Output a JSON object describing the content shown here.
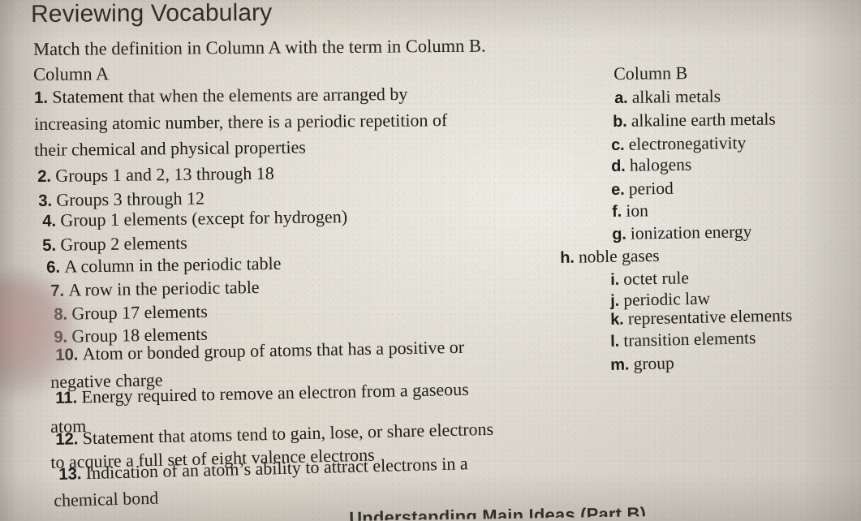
{
  "document": {
    "title": "Reviewing Vocabulary",
    "instruction": "Match the definition in Column A with the term in Column B.",
    "bleed_through_text": "        "
  },
  "column_a": {
    "heading": "Column A",
    "items": [
      {
        "number": "1.",
        "text": "Statement that when the elements are arranged by"
      },
      {
        "number": "",
        "text": "increasing atomic number, there is a periodic repetition of"
      },
      {
        "number": "",
        "text": "their chemical and physical properties"
      },
      {
        "number": "2.",
        "text": "Groups 1 and 2, 13 through 18"
      },
      {
        "number": "3.",
        "text": "Groups 3 through 12"
      },
      {
        "number": "4.",
        "text": "Group 1 elements (except for hydrogen)"
      },
      {
        "number": "5.",
        "text": "Group 2 elements"
      },
      {
        "number": "6.",
        "text": "A column in the periodic table"
      },
      {
        "number": "7.",
        "text": "A row in the periodic table"
      },
      {
        "number": "8.",
        "text": "Group 17 elements"
      },
      {
        "number": "9.",
        "text": "Group 18 elements"
      },
      {
        "number": "10.",
        "text": "Atom or bonded group of atoms that has a positive or"
      },
      {
        "number": "",
        "text": "negative charge"
      },
      {
        "number": "11.",
        "text": "Energy required to remove an electron from a gaseous"
      },
      {
        "number": "",
        "text": "atom"
      },
      {
        "number": "12.",
        "text": "Statement that atoms tend to gain, lose, or share electrons"
      },
      {
        "number": "",
        "text": "to acquire a full set of eight valence electrons"
      },
      {
        "number": "13.",
        "text": "Indication of an atom’s ability to attract electrons in a"
      },
      {
        "number": "",
        "text": "chemical bond"
      }
    ]
  },
  "column_b": {
    "heading": "Column B",
    "items": [
      {
        "letter": "a.",
        "text": "alkali metals"
      },
      {
        "letter": "b.",
        "text": "alkaline earth metals"
      },
      {
        "letter": "c.",
        "text": "electronegativity"
      },
      {
        "letter": "d.",
        "text": "halogens"
      },
      {
        "letter": "e.",
        "text": "period"
      },
      {
        "letter": "f.",
        "text": "ion"
      },
      {
        "letter": "g.",
        "text": "ionization energy"
      },
      {
        "letter": "h.",
        "text": "noble gases"
      },
      {
        "letter": "i.",
        "text": "octet rule"
      },
      {
        "letter": "j.",
        "text": "periodic law"
      },
      {
        "letter": "k.",
        "text": "representative elements"
      },
      {
        "letter": "l.",
        "text": "transition elements"
      },
      {
        "letter": "m.",
        "text": "group"
      }
    ]
  },
  "footer": {
    "cut_off_heading": "Understanding Main Ideas (Part B)"
  },
  "colors": {
    "paper": "#d7d3cb",
    "ink": "#201d19",
    "finger_tint": "#c49e98"
  }
}
